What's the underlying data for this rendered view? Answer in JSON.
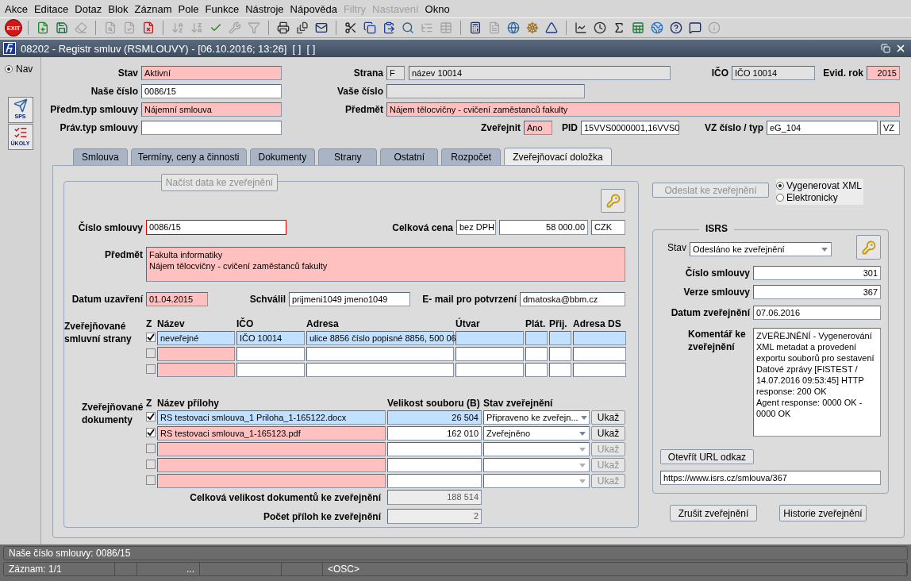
{
  "menu": [
    {
      "label": "Akce",
      "disabled": false
    },
    {
      "label": "Editace",
      "disabled": false
    },
    {
      "label": "Dotaz",
      "disabled": false
    },
    {
      "label": "Blok",
      "disabled": false
    },
    {
      "label": "Záznam",
      "disabled": false
    },
    {
      "label": "Pole",
      "disabled": false
    },
    {
      "label": "Funkce",
      "disabled": false
    },
    {
      "label": "Nástroje",
      "disabled": false
    },
    {
      "label": "Nápověda",
      "disabled": false
    },
    {
      "label": "Filtry",
      "disabled": true
    },
    {
      "label": "Nastavení",
      "disabled": true
    },
    {
      "label": "Okno",
      "disabled": false
    }
  ],
  "toolbar": [
    [
      {
        "kind": "exit",
        "label": "EXIT",
        "disabled": false
      }
    ],
    [
      {
        "kind": "insert",
        "disabled": false
      },
      {
        "kind": "save",
        "disabled": false
      },
      {
        "kind": "clear",
        "disabled": true
      }
    ],
    [
      {
        "kind": "query",
        "disabled": true
      },
      {
        "kind": "execute",
        "disabled": true
      },
      {
        "kind": "cancel",
        "disabled": false
      }
    ],
    [
      {
        "kind": "sortasc",
        "disabled": true
      },
      {
        "kind": "sortdesc",
        "disabled": true
      },
      {
        "kind": "check",
        "disabled": false
      },
      {
        "kind": "wrench",
        "disabled": true
      },
      {
        "kind": "filter",
        "disabled": true
      }
    ],
    [
      {
        "kind": "print",
        "disabled": false
      },
      {
        "kind": "printsetup",
        "disabled": false
      },
      {
        "kind": "mail",
        "disabled": false
      }
    ],
    [
      {
        "kind": "cut",
        "disabled": false
      },
      {
        "kind": "copy",
        "disabled": false
      },
      {
        "kind": "paste",
        "disabled": false
      },
      {
        "kind": "find",
        "disabled": false
      },
      {
        "kind": "list",
        "disabled": true
      },
      {
        "kind": "grid",
        "disabled": true
      }
    ],
    [
      {
        "kind": "calc",
        "disabled": false
      },
      {
        "kind": "doc",
        "disabled": true
      },
      {
        "kind": "globe",
        "disabled": false
      },
      {
        "kind": "wheel",
        "disabled": false
      },
      {
        "kind": "triangle",
        "disabled": false
      }
    ],
    [
      {
        "kind": "chart",
        "disabled": false
      },
      {
        "kind": "clock",
        "disabled": false
      },
      {
        "kind": "sigma",
        "disabled": false
      },
      {
        "kind": "excel",
        "disabled": false
      },
      {
        "kind": "browser",
        "disabled": false
      },
      {
        "kind": "help",
        "disabled": false
      },
      {
        "kind": "whatsthis",
        "disabled": false
      },
      {
        "kind": "info",
        "disabled": true
      }
    ]
  ],
  "window": {
    "title": "08202 - Registr smluv (RSMLOUVY) - [06.10.2016; 13:26]  [ ]  [ ]"
  },
  "sidebar": {
    "nav": {
      "label": "Nav",
      "selected": true
    },
    "buttons": [
      {
        "kind": "sps",
        "label": "SPS"
      },
      {
        "kind": "tasks",
        "label": "ÚKOLY"
      }
    ]
  },
  "header": [
    [
      {
        "label": "Stav",
        "value": "Aktivní",
        "kind": "required"
      },
      {
        "label": "Strana",
        "value": "F",
        "kind": "readonly"
      },
      {
        "value": "název 10014",
        "kind": "readonly"
      },
      {
        "label": "IČO",
        "value": "IČO 10014",
        "kind": "readonly"
      },
      {
        "label": "Evid. rok",
        "value": "2015",
        "kind": "required",
        "numeric": true
      }
    ],
    [
      {
        "label": "Naše číslo",
        "value": "0086/15",
        "kind": "input"
      },
      {
        "label": "Vaše číslo",
        "kind": "readonly"
      }
    ],
    [
      {
        "label": "Předm.typ smlouvy",
        "value": "Nájemní smlouva",
        "kind": "required"
      },
      {
        "label": "Předmět",
        "value": "Nájem tělocvičny - cvičení zaměstanců fakulty",
        "kind": "required"
      }
    ],
    [
      {
        "label": "Práv.typ smlouvy",
        "kind": "input"
      },
      {
        "label": "Zveřejnit",
        "value": "Ano",
        "kind": "required"
      },
      {
        "label": "PID",
        "value": "15VVS0000001,16VVS0",
        "kind": "input"
      },
      {
        "label": "VZ číslo / typ",
        "value": "eG_104",
        "kind": "input"
      },
      {
        "value": "VZ",
        "kind": "input"
      }
    ]
  ],
  "tabs": [
    {
      "label": "Smlouva",
      "selected": false
    },
    {
      "label": "Termíny, ceny a činnosti",
      "selected": false
    },
    {
      "label": "Dokumenty",
      "selected": false
    },
    {
      "label": "Strany",
      "selected": false
    },
    {
      "label": "Ostatní",
      "selected": false
    },
    {
      "label": "Rozpočet",
      "selected": false
    },
    {
      "label": "Zveřejňovací doložka",
      "selected": true
    }
  ],
  "publication": {
    "load_button": {
      "label": "Načíst data ke zveřejnění",
      "disabled": true
    },
    "contract_number": {
      "label": "Číslo smlouvy",
      "value": "0086/15",
      "focused": true
    },
    "price": {
      "label": "Celková cena",
      "basis": "bez DPH",
      "amount": "58 000.00",
      "currency": "CZK"
    },
    "subject": {
      "label": "Předmět",
      "lines": [
        "Fakulta informatiky",
        "Nájem tělocvičny - cvičení zaměstanců fakulty"
      ]
    },
    "concluded": {
      "label": "Datum uzavření",
      "value": "01.04.2015"
    },
    "approved": {
      "label": "Schválil",
      "value": "prijmeni1049 jmeno1049"
    },
    "email": {
      "label": "E- mail pro potvrzení",
      "value": "dmatoska@bbm.cz"
    },
    "parties": {
      "label": "Zveřejňované smluvní strany",
      "columns": [
        "Z",
        "Název",
        "IČO",
        "Adresa",
        "Útvar",
        "Plát.",
        "Přij.",
        "Adresa DS"
      ],
      "rows": [
        {
          "checked": true,
          "selected": true,
          "name": "neveřejné",
          "ico": "IČO 10014",
          "address": "ulice 8856 číslo popisné 8856, 500 06"
        },
        {
          "checked": false,
          "selected": false
        },
        {
          "checked": false,
          "selected": false
        }
      ]
    },
    "documents": {
      "label": "Zveřejňované dokumenty",
      "columns": [
        "Z",
        "Název přílohy",
        "Velikost souboru (B)",
        "Stav zveřejnění"
      ],
      "rows": [
        {
          "checked": true,
          "selected": true,
          "name": "RS testovaci smlouva_1 Priloha_1-165122.docx",
          "size": "26 504",
          "status": "Připraveno ke zveřejn...",
          "button": "Ukaž",
          "disabled": false
        },
        {
          "checked": true,
          "selected": false,
          "name": "RS testovaci smlouva_1-165123.pdf",
          "size": "162 010",
          "status": "Zveřejněno",
          "button": "Ukaž",
          "disabled": false
        },
        {
          "checked": false,
          "selected": false,
          "button": "Ukaž",
          "disabled": true
        },
        {
          "checked": false,
          "selected": false,
          "button": "Ukaž",
          "disabled": true
        },
        {
          "checked": false,
          "selected": false,
          "button": "Ukaž",
          "disabled": true
        }
      ]
    },
    "totals": [
      {
        "label": "Celková velikost dokumentů ke zveřejnění",
        "value": "188 514"
      },
      {
        "label": "Počet příloh ke zveřejnění",
        "value": "2"
      }
    ]
  },
  "send_button": {
    "label": "Odeslat ke zveřejnění",
    "disabled": true
  },
  "output_mode": [
    {
      "label": "Vygenerovat XML",
      "selected": true
    },
    {
      "label": "Elektronicky",
      "selected": false
    }
  ],
  "isrs": {
    "title": "ISRS",
    "status": {
      "label": "Stav",
      "value": "Odesláno ke zveřejnění"
    },
    "fields": [
      {
        "label": "Číslo smlouvy",
        "value": "301",
        "numeric": true
      },
      {
        "label": "Verze smlouvy",
        "value": "367",
        "numeric": true
      },
      {
        "label": "Datum zveřejnění",
        "value": "07.06.2016",
        "numeric": false
      }
    ],
    "comment": {
      "label": "Komentář ke zveřejnění",
      "lines": [
        "ZVEŘEJNĚNÍ - Vygenerování XML metadat a provedení exportu souborů pro sestavení Datové zprávy [FISTEST / 14.07.2016 09:53:45] HTTP response: 200 OK",
        "Agent response: 0000 OK  - 0000 OK"
      ]
    },
    "url_button": "Otevřít URL odkaz",
    "url": "https://www.isrs.cz/smlouva/367"
  },
  "actions": [
    {
      "label": "Zrušit zveřejnění"
    },
    {
      "label": "Historie zveřejnění"
    }
  ],
  "status_bar": {
    "message": "Naše číslo smlouvy: 0086/15",
    "segments": [
      "Záznam: 1/1",
      "...",
      "<OSC>"
    ]
  }
}
